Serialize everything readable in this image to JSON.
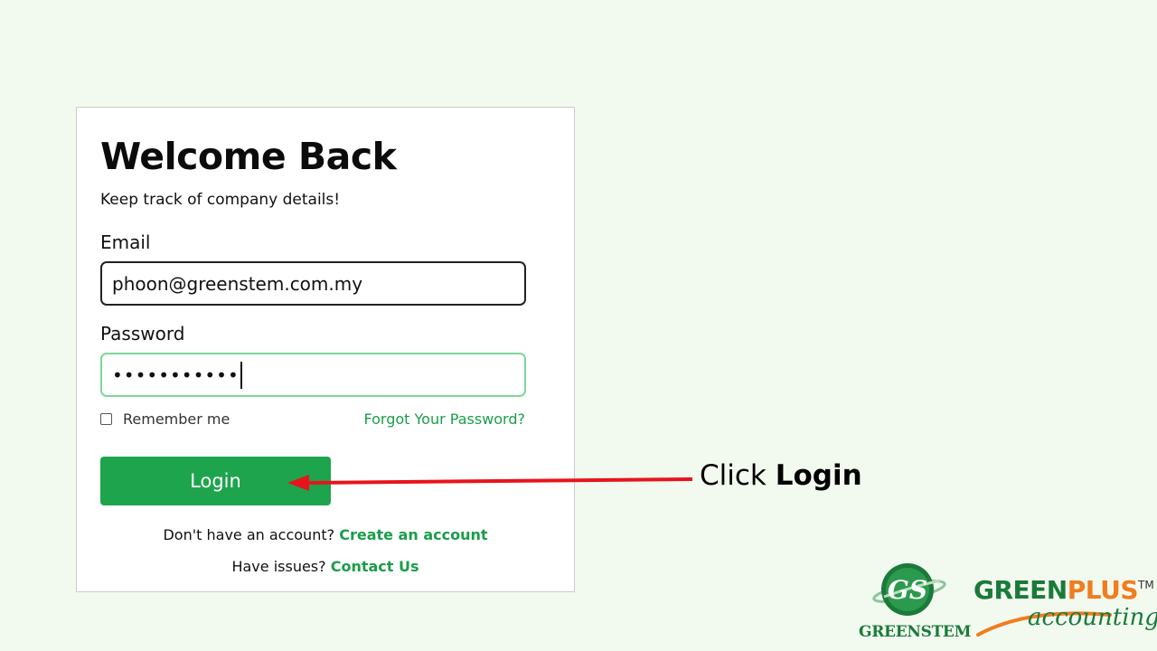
{
  "login_card": {
    "title": "Welcome Back",
    "subtitle": "Keep track of company details!",
    "email_label": "Email",
    "email_value": "phoon@greenstem.com.my",
    "password_label": "Password",
    "password_value": "•••••••••••",
    "remember_label": "Remember me",
    "remember_checked": false,
    "forgot_link": "Forgot Your Password?",
    "login_button": "Login",
    "signup_prompt": "Don't have an account?",
    "signup_link": "Create an account",
    "issues_prompt": "Have issues?",
    "contact_link": "Contact Us"
  },
  "annotation": {
    "prefix": "Click",
    "target": "Login"
  },
  "logos": {
    "greenstem_mark": "GS",
    "greenstem_name": "GREENSTEM",
    "greenplus_part1": "GREEN",
    "greenplus_part2": "PLUS",
    "greenplus_tm": "TM",
    "greenplus_sub": "accounting"
  },
  "colors": {
    "background": "#f2f9ef",
    "accent_green": "#1ea44d",
    "link_green": "#1a9d4a",
    "arrow_red": "#e8141b",
    "brand_orange": "#f07d1e"
  }
}
